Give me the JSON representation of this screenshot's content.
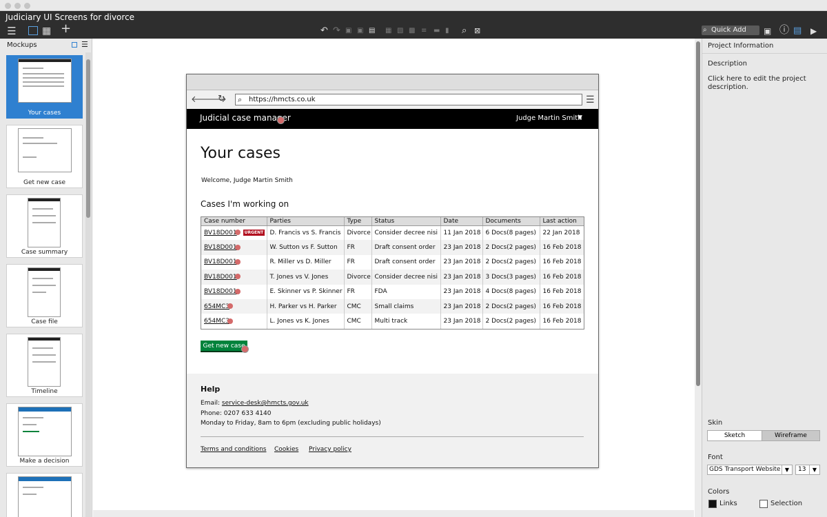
{
  "window": {
    "title": "Judiciary UI Screens for divorce"
  },
  "toolbar": {
    "quick_add": "Quick Add",
    "icons": [
      "menu-icon",
      "single-pane-icon",
      "grid-icon",
      "add-icon",
      "undo-icon",
      "redo-icon",
      "copy-icon",
      "paste-icon",
      "clipboard-icon",
      "group-icon",
      "ungroup-icon",
      "front-icon",
      "align-icon",
      "lock-icon",
      "trash-icon",
      "search-icon",
      "cross-icon",
      "markup-icon",
      "info-icon",
      "properties-icon",
      "present-icon"
    ]
  },
  "left_panel": {
    "title": "Mockups",
    "thumbnails": [
      {
        "label": "Your cases",
        "selected": true
      },
      {
        "label": "Get new case",
        "selected": false
      },
      {
        "label": "Case summary",
        "selected": false
      },
      {
        "label": "Case file",
        "selected": false
      },
      {
        "label": "Timeline",
        "selected": false
      },
      {
        "label": "Make a decision",
        "selected": false
      },
      {
        "label": "",
        "selected": false
      }
    ]
  },
  "browser": {
    "url": "https://hmcts.co.uk",
    "service_name": "Judicial case manager",
    "user_name": "Judge Martin Smith",
    "page_title": "Your cases",
    "welcome": "Welcome, Judge Martin Smith",
    "subheading": "Cases I'm working on",
    "table": {
      "headers": [
        "Case number",
        "Parties",
        "Type",
        "Status",
        "Date",
        "Documents",
        "Last action"
      ],
      "rows": [
        {
          "case": "BV18D001",
          "urgent": "URGENT",
          "parties": "D. Francis vs S. Francis",
          "type": "Divorce",
          "status": "Consider decree nisi",
          "date": "11 Jan 2018",
          "docs": "6 Docs(8 pages)",
          "last": "22 Jan 2018"
        },
        {
          "case": "BV18D001",
          "urgent": "",
          "parties": "W. Sutton vs F. Sutton",
          "type": "FR",
          "status": "Draft consent order",
          "date": "23 Jan 2018",
          "docs": "2 Docs(2 pages)",
          "last": "16 Feb 2018"
        },
        {
          "case": "BV18D001",
          "urgent": "",
          "parties": "R. Miller vs D. Miller",
          "type": "FR",
          "status": "Draft consent order",
          "date": "23 Jan 2018",
          "docs": "2 Docs(2 pages)",
          "last": "16 Feb 2018"
        },
        {
          "case": "BV18D001",
          "urgent": "",
          "parties": "T. Jones vs V. Jones",
          "type": "Divorce",
          "status": "Consider decree nisi",
          "date": "23 Jan 2018",
          "docs": "3 Docs(3 pages)",
          "last": "16 Feb 2018"
        },
        {
          "case": "BV18D001",
          "urgent": "",
          "parties": "E. Skinner vs P. Skinner",
          "type": "FR",
          "status": "FDA",
          "date": "23 Jan 2018",
          "docs": "4 Docs(8 pages)",
          "last": "16 Feb 2018"
        },
        {
          "case": "654MC3",
          "urgent": "",
          "parties": "H. Parker vs H. Parker",
          "type": "CMC",
          "status": "Small claims",
          "date": "23 Jan 2018",
          "docs": "2 Docs(2 pages)",
          "last": "16 Feb 2018"
        },
        {
          "case": "654MC3",
          "urgent": "",
          "parties": "L. Jones vs K. Jones",
          "type": "CMC",
          "status": "Multi track",
          "date": "23 Jan 2018",
          "docs": "2 Docs(2 pages)",
          "last": "16 Feb 2018"
        }
      ]
    },
    "button_new_case": "Get new case",
    "footer": {
      "help_title": "Help",
      "email_label": "Email:",
      "email": "service-desk@hmcts.gov.uk",
      "phone": "Phone:  0207 633 4140",
      "hours": "Monday to Friday, 8am to 6pm (excluding public holidays)",
      "links": [
        "Terms and conditions",
        "Cookies",
        "Privacy policy"
      ]
    }
  },
  "right_panel": {
    "title": "Project Information",
    "description_label": "Description",
    "description_text": "Click here to edit the project description.",
    "skin_label": "Skin",
    "skin_options": [
      "Sketch",
      "Wireframe"
    ],
    "skin_selected": "Wireframe",
    "font_label": "Font",
    "font_value": "GDS Transport Website L",
    "font_size": "13",
    "colors_label": "Colors",
    "links_label": "Links",
    "selection_label": "Selection"
  },
  "colors": {
    "govbar": "#000000",
    "button": "#00823b",
    "urgent": "#b10e1e",
    "selected_thumb": "#2f80d0"
  }
}
